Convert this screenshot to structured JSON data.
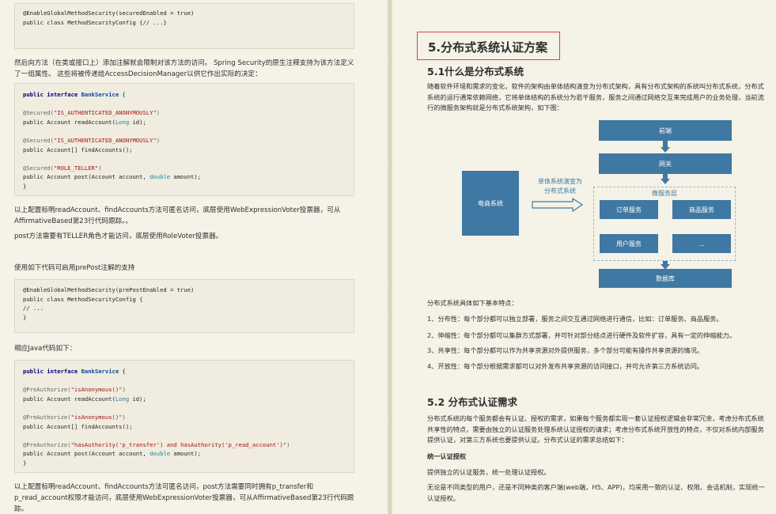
{
  "left": {
    "code1": [
      "@EnableGlobalMethodSecurity(securedEnabled = true)",
      "public class MethodSecurityConfig {// ...}"
    ],
    "para1": "然后向方法（在类或接口上）添加注解就会限制对该方法的访问。 Spring Security的原生注释支持为该方法定义了一组属性。 这些将被传递给AccessDecisionManager以供它作出实际的决定：",
    "code2": {
      "line1_kw": "public interface",
      "line1_name": "BankService",
      "line1_end": " {",
      "l3_ann": "@Secured(",
      "l3_str": "\"IS_AUTHENTICATED_ANONYMOUSLY\"",
      "l3_end": ")",
      "l4": "public Account readAccount(",
      "l4_typ": "Long",
      "l4_end": " id);",
      "l6_ann": "@Secured(",
      "l6_str": "\"IS_AUTHENTICATED_ANONYMOUSLY\"",
      "l6_end": ")",
      "l7": "public Account[] findAccounts();",
      "l9_ann": "@Secured(",
      "l9_str": "\"ROLE_TELLER\"",
      "l9_end": ")",
      "l10": "public Account post(Account account, ",
      "l10_typ": "double",
      "l10_end": " amount);",
      "close": "}"
    },
    "para2": "以上配置标明readAccount、findAccounts方法可匿名访问，底层使用WebExpressionVoter投票器，可从AffirmativeBased第23行代码跟踪。。",
    "para3": "post方法需要有TELLER角色才能访问，底层使用RoleVoter投票器。",
    "para4": "使用如下代码可启用prePost注解的支持",
    "code3": [
      "@EnableGlobalMethodSecurity(prePostEnabled = true)",
      "public class MethodSecurityConfig {",
      "// ...",
      "}"
    ],
    "para5": "相应Java代码如下：",
    "code4": {
      "line1_kw": "public interface",
      "line1_name": "BankService",
      "line1_end": " {",
      "l3_ann": "@PreAuthorize(",
      "l3_str": "\"isAnonymous()\"",
      "l3_end": ")",
      "l4": "public Account readAccount(",
      "l4_typ": "Long",
      "l4_end": " id);",
      "l6_ann": "@PreAuthorize(",
      "l6_str": "\"isAnonymous()\"",
      "l6_end": ")",
      "l7": "public Account[] findAccounts();",
      "l9_ann": "@PreAuthorize(",
      "l9_str": "\"hasAuthority('p_transfer') and hasAuthority('p_read_account')\"",
      "l9_end": ")",
      "l10": "public Account post(Account account, ",
      "l10_typ": "double",
      "l10_end": " amount);",
      "close": "}"
    },
    "para6": "以上配置标明readAccount、findAccounts方法可匿名访问，post方法需要同时拥有p_transfer和p_read_account权限才能访问，底层使用WebExpressionVoter投票器，可从AffirmativeBased第23行代码跟踪。"
  },
  "right": {
    "h1": "5.分布式系统认证方案",
    "h2_1": "5.1什么是分布式系统",
    "intro": "随着软件环境和需求的变化，软件的架构由单体结构演变为分布式架构，具有分布式架构的系统叫分布式系统，分布式系统的运行通常依赖网络，它将单体结构的系统分为若干服务，服务之间通过网络交互来完成用户的业务处理，当前流行的微服务架构就是分布式系统架构，如下图：",
    "diagram": {
      "frontend": "前端",
      "gateway": "网关",
      "ecommerce": "电商系统",
      "evolve_label_1": "单体系统演变为",
      "evolve_label_2": "分布式系统",
      "microservice_layer": "微服务层",
      "order": "订单服务",
      "product": "商品服务",
      "user": "用户服务",
      "more": "...",
      "database": "数据库"
    },
    "features_intro": "分布式系统具体如下基本特点：",
    "features": [
      "1、分布性：每个部分都可以独立部署，服务之间交互通过网络进行通信，比如：订单服务、商品服务。",
      "2、伸缩性：每个部分都可以集群方式部署，并可针对部分结点进行硬件及软件扩容，具有一定的伸缩能力。",
      "3、共享性：每个部分都可以作为共享资源对外提供服务，多个部分可能有操作共享资源的情况。",
      "4、开放性：每个部分根据需求都可以对外发布共享资源的访问接口，并可允许第三方系统访问。"
    ],
    "h2_2": "5.2 分布式认证需求",
    "req_para": "分布式系统的每个服务都会有认证、授权的需求，如果每个服务都实现一套认证授权逻辑会非常冗余，考虑分布式系统共享性的特点，需要由独立的认证服务处理系统认证授权的请求；考虑分布式系统开放性的特点，不仅对系统内部服务提供认证，对第三方系统也要提供认证。分布式认证的需求总结如下：",
    "unified_title": "统一认证授权",
    "unified_1": "提供独立的认证服务，统一处理认证授权。",
    "unified_2": "无论是不同类型的用户，还是不同种类的客户端(web端，H5、APP)，均采用一致的认证、权限、会话机制，实现统一认证授权。"
  },
  "colors": {
    "accent_box": "#3f78a2",
    "heading_border": "#d64545"
  }
}
